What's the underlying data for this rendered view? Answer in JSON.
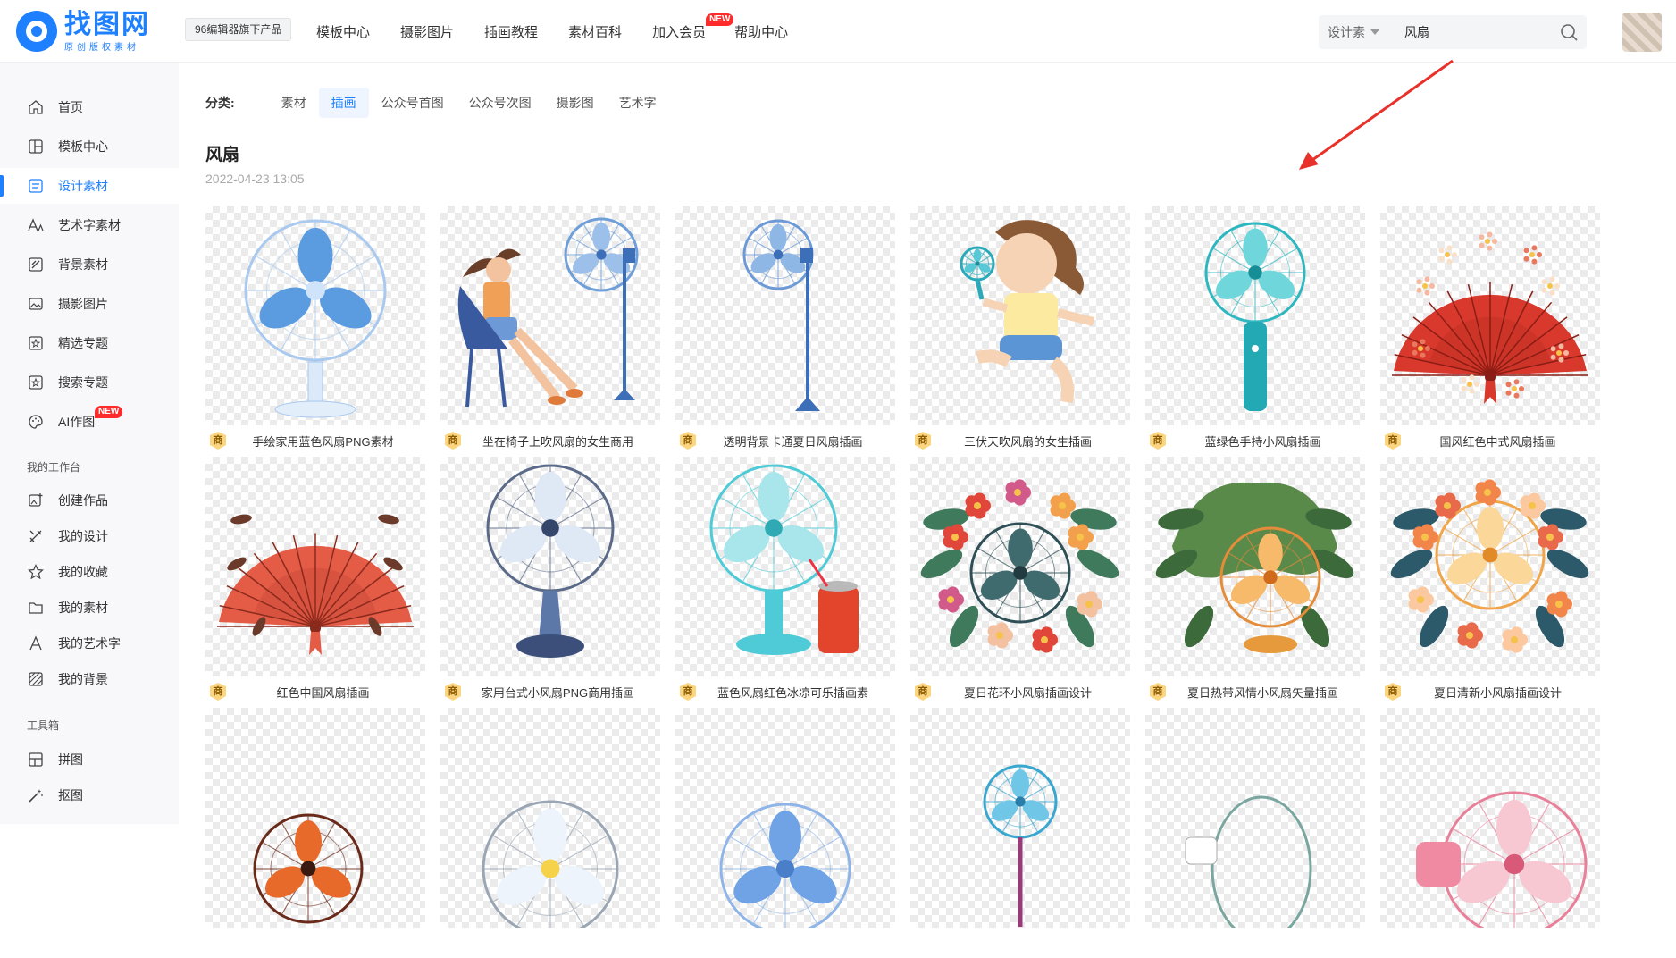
{
  "header": {
    "logo_name": "找图网",
    "logo_sub": "原创版权素材",
    "sub_brand": "96编辑器旗下产品",
    "nav": [
      {
        "label": "模板中心"
      },
      {
        "label": "摄影图片"
      },
      {
        "label": "插画教程"
      },
      {
        "label": "素材百科"
      },
      {
        "label": "加入会员",
        "badge": "NEW"
      },
      {
        "label": "帮助中心"
      }
    ],
    "search": {
      "scope": "设计素",
      "value": "风扇"
    }
  },
  "sidebar": {
    "items": [
      {
        "label": "首页",
        "icon": "home-icon"
      },
      {
        "label": "模板中心",
        "icon": "template-icon"
      },
      {
        "label": "设计素材",
        "icon": "design-material-icon",
        "active": true
      },
      {
        "label": "艺术字素材",
        "icon": "art-text-icon"
      },
      {
        "label": "背景素材",
        "icon": "background-icon"
      },
      {
        "label": "摄影图片",
        "icon": "photo-icon"
      },
      {
        "label": "精选专题",
        "icon": "featured-topic-icon"
      },
      {
        "label": "搜索专题",
        "icon": "search-topic-icon"
      },
      {
        "label": "AI作图",
        "icon": "ai-palette-icon",
        "badge": "NEW"
      }
    ],
    "workspace_title": "我的工作台",
    "workspace": [
      {
        "label": "创建作品",
        "icon": "create-work-icon"
      },
      {
        "label": "我的设计",
        "icon": "my-design-icon"
      },
      {
        "label": "我的收藏",
        "icon": "star-icon"
      },
      {
        "label": "我的素材",
        "icon": "folder-icon"
      },
      {
        "label": "我的艺术字",
        "icon": "letter-a-icon"
      },
      {
        "label": "我的背景",
        "icon": "pattern-icon"
      }
    ],
    "tools_title": "工具箱",
    "tools": [
      {
        "label": "拼图",
        "icon": "collage-icon"
      },
      {
        "label": "抠图",
        "icon": "magic-wand-icon"
      }
    ]
  },
  "main": {
    "category_label": "分类:",
    "categories": [
      {
        "label": "素材"
      },
      {
        "label": "插画",
        "active": true
      },
      {
        "label": "公众号首图"
      },
      {
        "label": "公众号次图"
      },
      {
        "label": "摄影图"
      },
      {
        "label": "艺术字"
      }
    ],
    "title": "风扇",
    "date": "2022-04-23 13:05",
    "badge_label": "商",
    "cards": [
      {
        "title": "手绘家用蓝色风扇PNG素材",
        "art": "blue-standing-fan"
      },
      {
        "title": "坐在椅子上吹风扇的女生商用",
        "art": "girl-on-chair-fan"
      },
      {
        "title": "透明背景卡通夏日风扇插画",
        "art": "cartoon-standing-fan"
      },
      {
        "title": "三伏天吹风扇的女生插画",
        "art": "girl-handheld-fan"
      },
      {
        "title": "蓝绿色手持小风扇插画",
        "art": "teal-handheld-fan"
      },
      {
        "title": "国风红色中式风扇插画",
        "art": "red-chinese-folding-fan"
      },
      {
        "title": "红色中国风扇插画",
        "art": "red-folding-fan"
      },
      {
        "title": "家用台式小风扇PNG商用插画",
        "art": "desk-fan-line"
      },
      {
        "title": "蓝色风扇红色冰凉可乐插画素",
        "art": "blue-fan-cola"
      },
      {
        "title": "夏日花环小风扇插画设计",
        "art": "floral-fan"
      },
      {
        "title": "夏日热带风情小风扇矢量插画",
        "art": "tropical-fan"
      },
      {
        "title": "夏日清新小风扇插画设计",
        "art": "fresh-fan"
      },
      {
        "title": "",
        "art": "orange-fan"
      },
      {
        "title": "",
        "art": "white-fan"
      },
      {
        "title": "",
        "art": "blue-fan-partial"
      },
      {
        "title": "",
        "art": "small-blue-fan"
      },
      {
        "title": "",
        "art": "white-side-fan"
      },
      {
        "title": "",
        "art": "pink-fan"
      }
    ]
  },
  "colors": {
    "accent": "#1e80ff",
    "badge_red": "#ff2a2a",
    "arrow_red": "#e8312a"
  }
}
